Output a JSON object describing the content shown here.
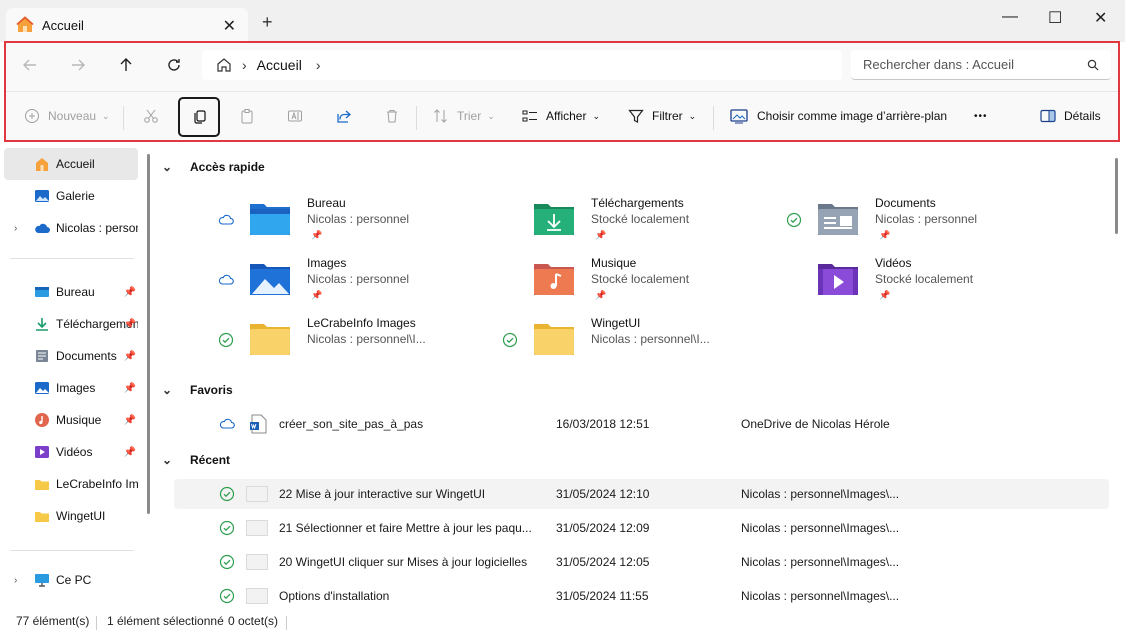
{
  "tab": {
    "title": "Accueil",
    "close_icon": "✕",
    "new_tab_icon": "+"
  },
  "window_controls": {
    "minimize": "—",
    "maximize": "☐",
    "close": "✕"
  },
  "address": {
    "current": "Accueil"
  },
  "search": {
    "placeholder": "Rechercher dans : Accueil"
  },
  "toolbar": {
    "new_label": "Nouveau",
    "sort_label": "Trier",
    "view_label": "Afficher",
    "filter_label": "Filtrer",
    "wallpaper_label": "Choisir comme image d’arrière-plan",
    "more_label": "•••",
    "details_label": "Détails"
  },
  "sidebar": {
    "items": [
      {
        "label": "Accueil",
        "icon": "home-icon"
      },
      {
        "label": "Galerie",
        "icon": "gallery-icon"
      },
      {
        "label": "Nicolas : personnel",
        "icon": "onedrive-icon"
      },
      {
        "label": "Bureau",
        "icon": "desktop-icon"
      },
      {
        "label": "Téléchargements",
        "icon": "downloads-icon"
      },
      {
        "label": "Documents",
        "icon": "documents-icon"
      },
      {
        "label": "Images",
        "icon": "images-icon"
      },
      {
        "label": "Musique",
        "icon": "music-icon"
      },
      {
        "label": "Vidéos",
        "icon": "videos-icon"
      },
      {
        "label": "LeCrabeInfo Images",
        "icon": "folder-icon"
      },
      {
        "label": "WingetUI",
        "icon": "folder-icon"
      },
      {
        "label": "Ce PC",
        "icon": "pc-icon"
      }
    ]
  },
  "sections": {
    "quick_access": "Accès rapide",
    "favorites": "Favoris",
    "recent": "Récent"
  },
  "quick_access": [
    {
      "name": "Bureau",
      "sub": "Nicolas : personnel"
    },
    {
      "name": "Téléchargements",
      "sub": "Stocké localement"
    },
    {
      "name": "Documents",
      "sub": "Nicolas : personnel"
    },
    {
      "name": "Images",
      "sub": "Nicolas : personnel"
    },
    {
      "name": "Musique",
      "sub": "Stocké localement"
    },
    {
      "name": "Vidéos",
      "sub": "Stocké localement"
    },
    {
      "name": "LeCrabeInfo Images",
      "sub": "Nicolas : personnel\\I..."
    },
    {
      "name": "WingetUI",
      "sub": "Nicolas : personnel\\I..."
    }
  ],
  "favorites": [
    {
      "name": "créer_son_site_pas_à_pas",
      "date": "16/03/2018 12:51",
      "location": "OneDrive de Nicolas Hérole"
    }
  ],
  "recent": [
    {
      "name": "22 Mise à jour interactive sur WingetUI",
      "date": "31/05/2024 12:10",
      "location": "Nicolas : personnel\\Images\\..."
    },
    {
      "name": "21 Sélectionner et faire Mettre à jour les paqu...",
      "date": "31/05/2024 12:09",
      "location": "Nicolas : personnel\\Images\\..."
    },
    {
      "name": "20 WingetUI cliquer sur Mises à jour logicielles",
      "date": "31/05/2024 12:05",
      "location": "Nicolas : personnel\\Images\\..."
    },
    {
      "name": "Options d'installation",
      "date": "31/05/2024 11:55",
      "location": "Nicolas : personnel\\Images\\..."
    }
  ],
  "status": {
    "count": "77 élément(s)",
    "selected": "1 élément sélectionné",
    "size": "0 octet(s)"
  },
  "colors": {
    "highlight": "#e0383e",
    "accent": "#0067c0",
    "ok_green": "#2e9e4f",
    "folder_yellow": "#f7c948"
  }
}
